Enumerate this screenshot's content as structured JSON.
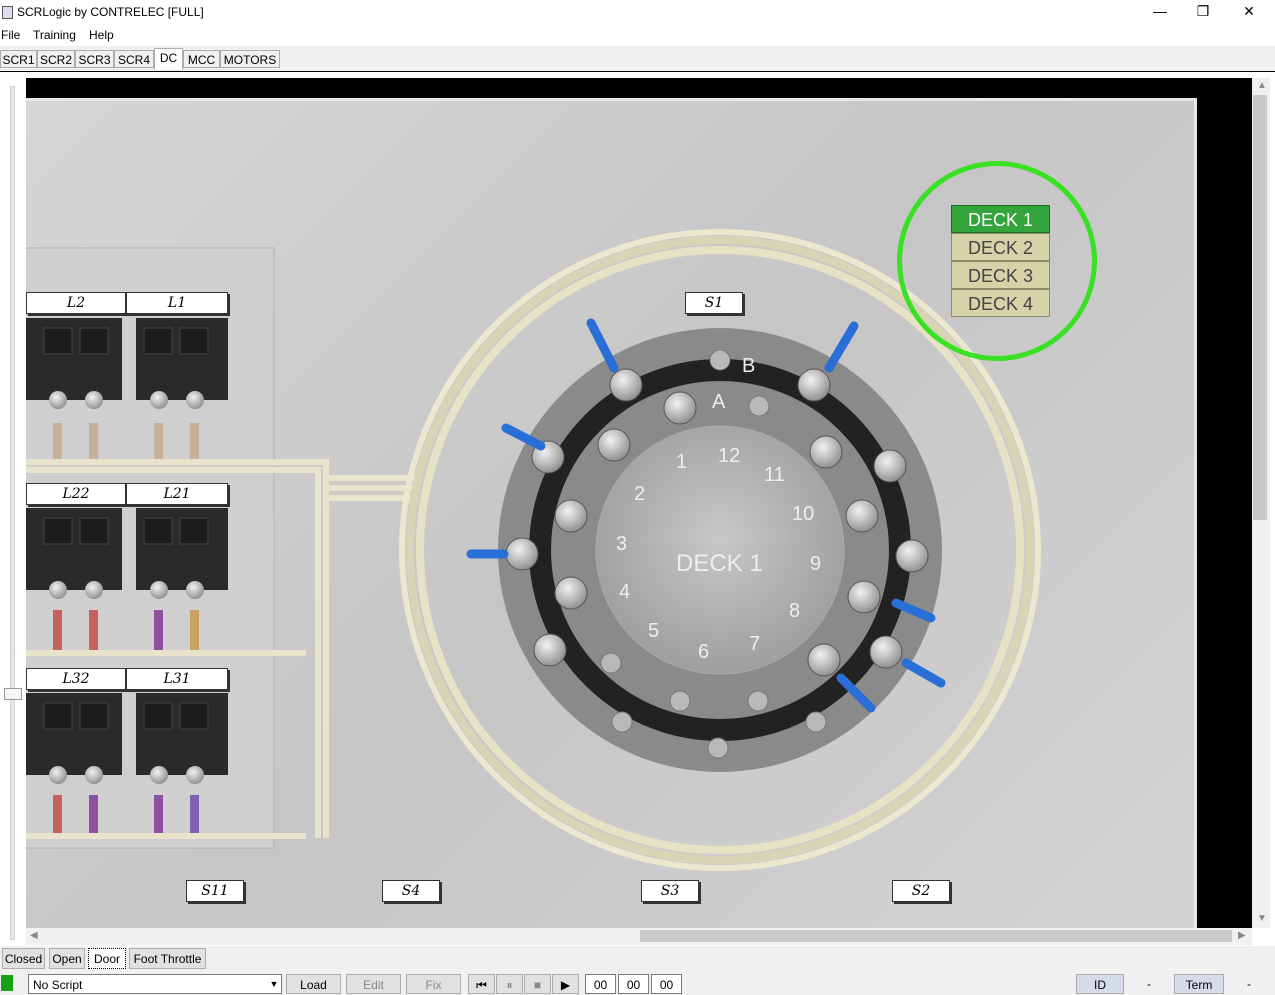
{
  "window": {
    "title": "SCRLogic by CONTRELEC [FULL]",
    "min": "—",
    "max": "❐",
    "close": "✕"
  },
  "menu": [
    "File",
    "Training",
    "Help"
  ],
  "tabs": [
    "SCR1",
    "SCR2",
    "SCR3",
    "SCR4",
    "DC",
    "MCC",
    "MOTORS"
  ],
  "active_tab": "DC",
  "deck_menu": [
    "DECK 1",
    "DECK 2",
    "DECK 3",
    "DECK 4"
  ],
  "selected_deck": "DECK 1",
  "switch": {
    "center_label": "DECK 1",
    "contacts": [
      "1",
      "2",
      "3",
      "4",
      "5",
      "6",
      "7",
      "8",
      "9",
      "10",
      "11",
      "12"
    ],
    "letters": [
      "A",
      "B"
    ]
  },
  "terminal_labels": {
    "L2": "L2",
    "L1": "L1",
    "L22": "L22",
    "L21": "L21",
    "L32": "L32",
    "L31": "L31",
    "S1": "S1",
    "S11": "S11",
    "S4": "S4",
    "S3": "S3",
    "S2": "S2"
  },
  "bottom_buttons": [
    "Closed",
    "Open",
    "Door",
    "Foot Throttle"
  ],
  "active_bottom_button": "Door",
  "status": {
    "script": "No Script",
    "load": "Load",
    "edit": "Edit",
    "fix": "Fix",
    "time": [
      "00",
      "00",
      "00"
    ],
    "id": "ID",
    "id_value": "-",
    "term": "Term",
    "term_value": "-"
  },
  "colors": {
    "highlight": "#3ae024",
    "deck_selected": "#34a43c",
    "deck_normal": "#d6d3a8"
  }
}
